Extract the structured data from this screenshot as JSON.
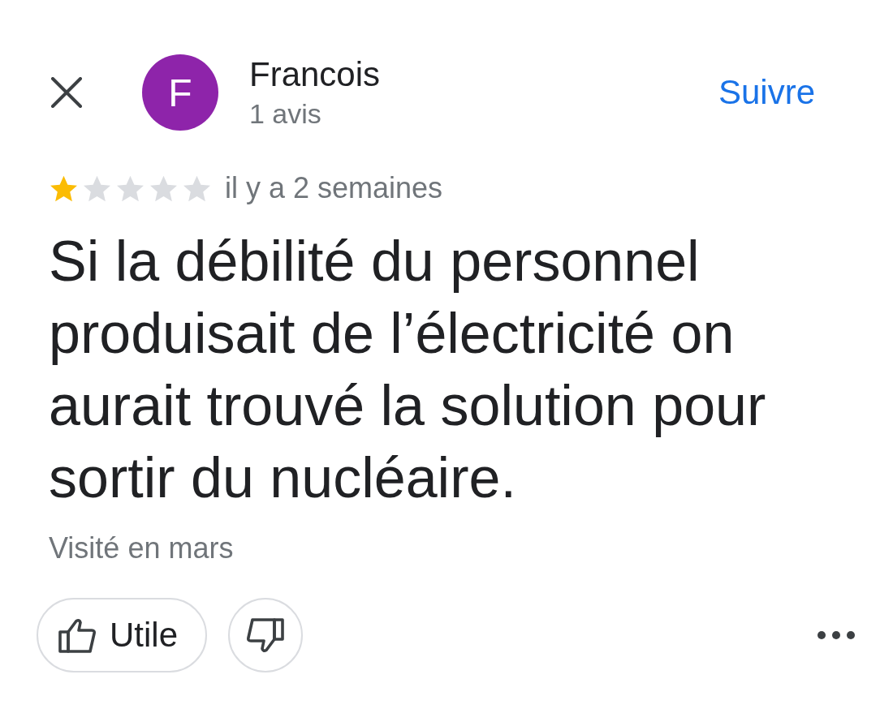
{
  "header": {
    "avatar_initial": "F",
    "author_name": "Francois",
    "review_count": "1 avis",
    "follow_button": "Suivre"
  },
  "review": {
    "stars": 1,
    "time": "il y a 2 semaines",
    "text": "Si la débilité du personnel produisait de l’électricité on aurait trouvé la solution pour sortir du nucléaire.",
    "visited": "Visité en mars"
  },
  "actions": {
    "helpful_button": "Utile"
  }
}
